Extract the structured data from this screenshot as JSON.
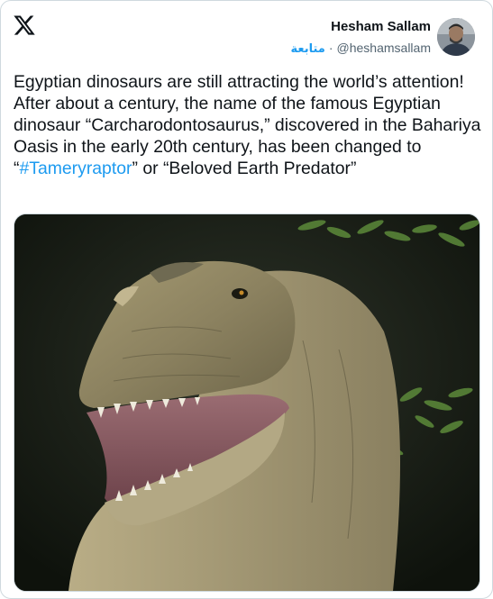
{
  "author": {
    "name": "Hesham Sallam",
    "follow_label": "متابعة",
    "separator": "·",
    "handle": "@heshamsallam"
  },
  "tweet": {
    "line1": "Egyptian dinosaurs are still attracting the world’s attention!",
    "line2_prefix": "After about a century, the name of the famous Egyptian dinosaur “Carcharodontosaurus,” discovered in the Bahariya Oasis in the early 20th century, has been changed to “",
    "hashtag": "#Tameryraptor",
    "line2_suffix": "” or “Beloved Earth Predator”"
  },
  "icons": {
    "logo": "x-logo-icon",
    "avatar": "avatar",
    "media": "dinosaur-illustration"
  },
  "colors": {
    "accent": "#1d9bf0",
    "text": "#0f1419",
    "muted": "#536471"
  }
}
